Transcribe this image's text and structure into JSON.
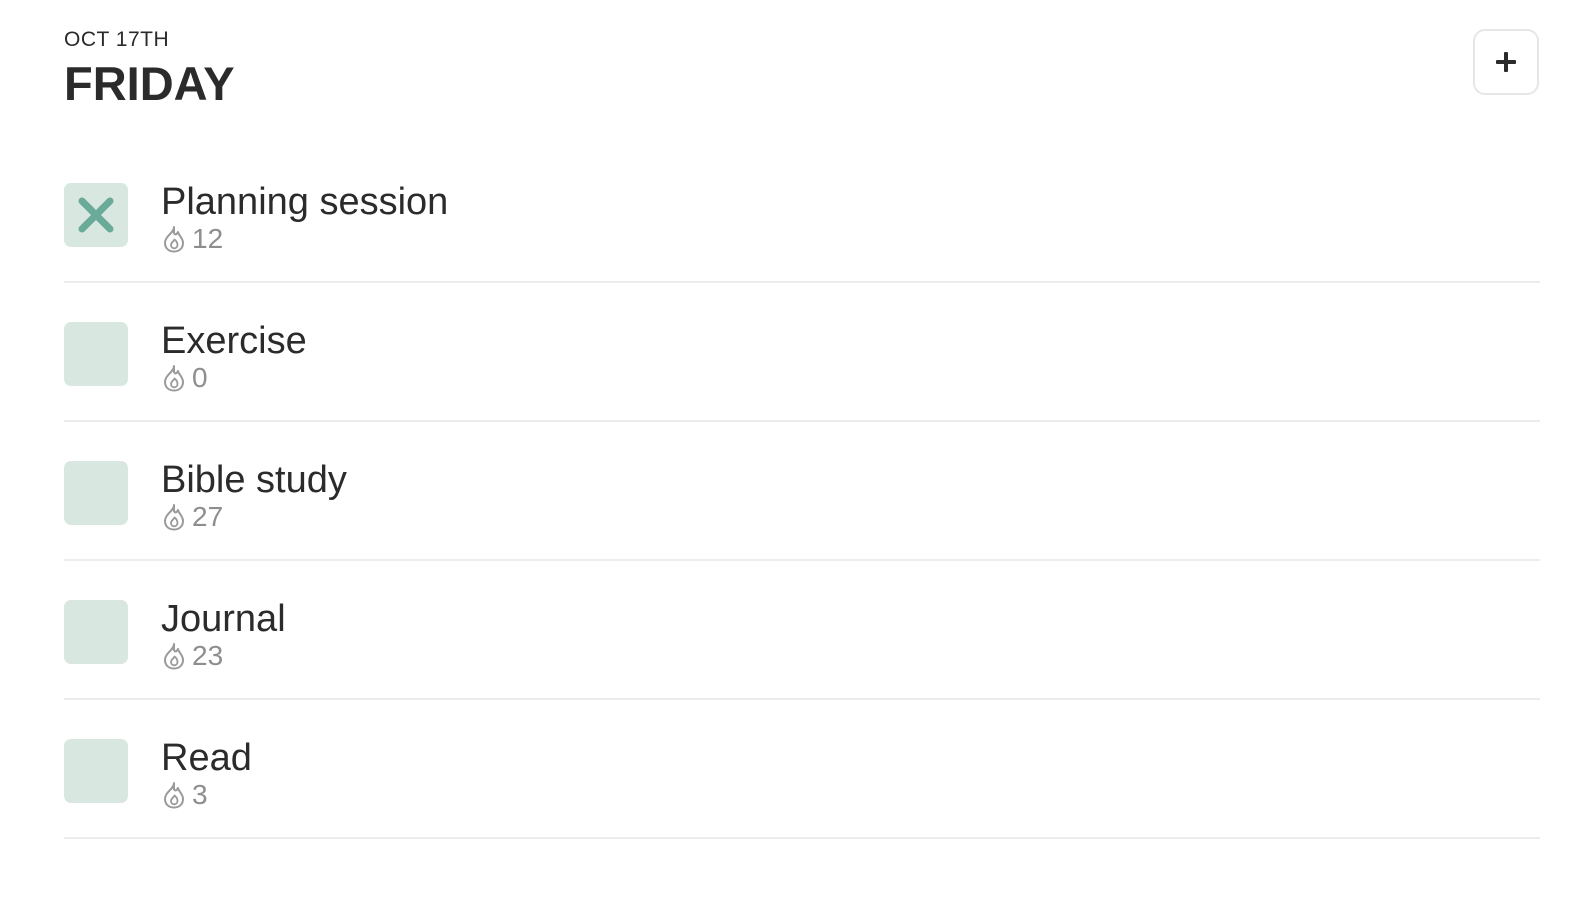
{
  "header": {
    "date": "OCT 17TH",
    "day": "FRIDAY"
  },
  "add_button": {
    "icon": "plus-icon"
  },
  "colors": {
    "checkbox_bg": "#d8e8e1",
    "check_mark": "#6aaa98",
    "text": "#2b2b2b",
    "muted": "#8e8e8e"
  },
  "habits": [
    {
      "name": "Planning session",
      "streak": "12",
      "status": "x",
      "icon": "flame-icon"
    },
    {
      "name": "Exercise",
      "streak": "0",
      "status": "empty",
      "icon": "flame-icon"
    },
    {
      "name": "Bible study",
      "streak": "27",
      "status": "empty",
      "icon": "flame-icon"
    },
    {
      "name": "Journal",
      "streak": "23",
      "status": "empty",
      "icon": "flame-icon"
    },
    {
      "name": "Read",
      "streak": "3",
      "status": "empty",
      "icon": "flame-icon"
    }
  ]
}
